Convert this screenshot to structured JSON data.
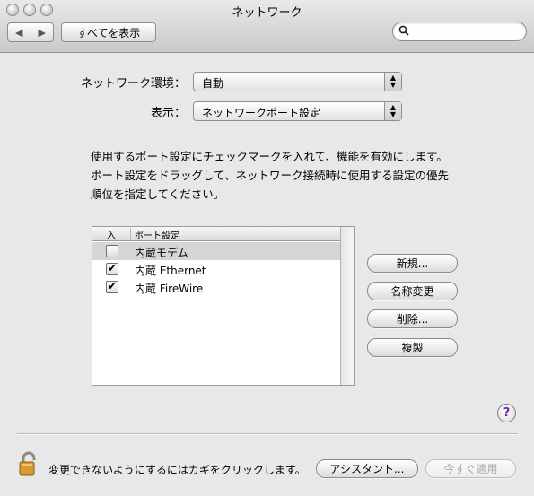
{
  "window": {
    "title": "ネットワーク"
  },
  "toolbar": {
    "back_icon": "◀",
    "forward_icon": "▶",
    "show_all_label": "すべてを表示",
    "search_placeholder": ""
  },
  "settings": {
    "location_label": "ネットワーク環境：",
    "location_value": "自動",
    "show_label": "表示：",
    "show_value": "ネットワークポート設定"
  },
  "description": {
    "line1": "使用するポート設定にチェックマークを入れて、機能を有効にします。",
    "line2": "ポート設定をドラッグして、ネットワーク接続時に使用する設定の優先",
    "line3": "順位を指定してください。"
  },
  "ports_table": {
    "headers": [
      "入",
      "ポート設定"
    ],
    "rows": [
      {
        "checked": false,
        "name": "内蔵モデム",
        "selected": true
      },
      {
        "checked": true,
        "name": "内蔵 Ethernet",
        "selected": false
      },
      {
        "checked": true,
        "name": "内蔵 FireWire",
        "selected": false
      }
    ]
  },
  "actions": {
    "new_label": "新規...",
    "rename_label": "名称変更",
    "delete_label": "削除...",
    "duplicate_label": "複製"
  },
  "help": {
    "label": "?"
  },
  "footer": {
    "lock_text": "変更できないようにするにはカギをクリックします。",
    "assistant_label": "アシスタント...",
    "apply_label": "今すぐ適用"
  },
  "colors": {
    "window_bg": "#e8e8e8",
    "selected_row": "#d6d6d6",
    "help_accent": "#6b2aa0"
  }
}
